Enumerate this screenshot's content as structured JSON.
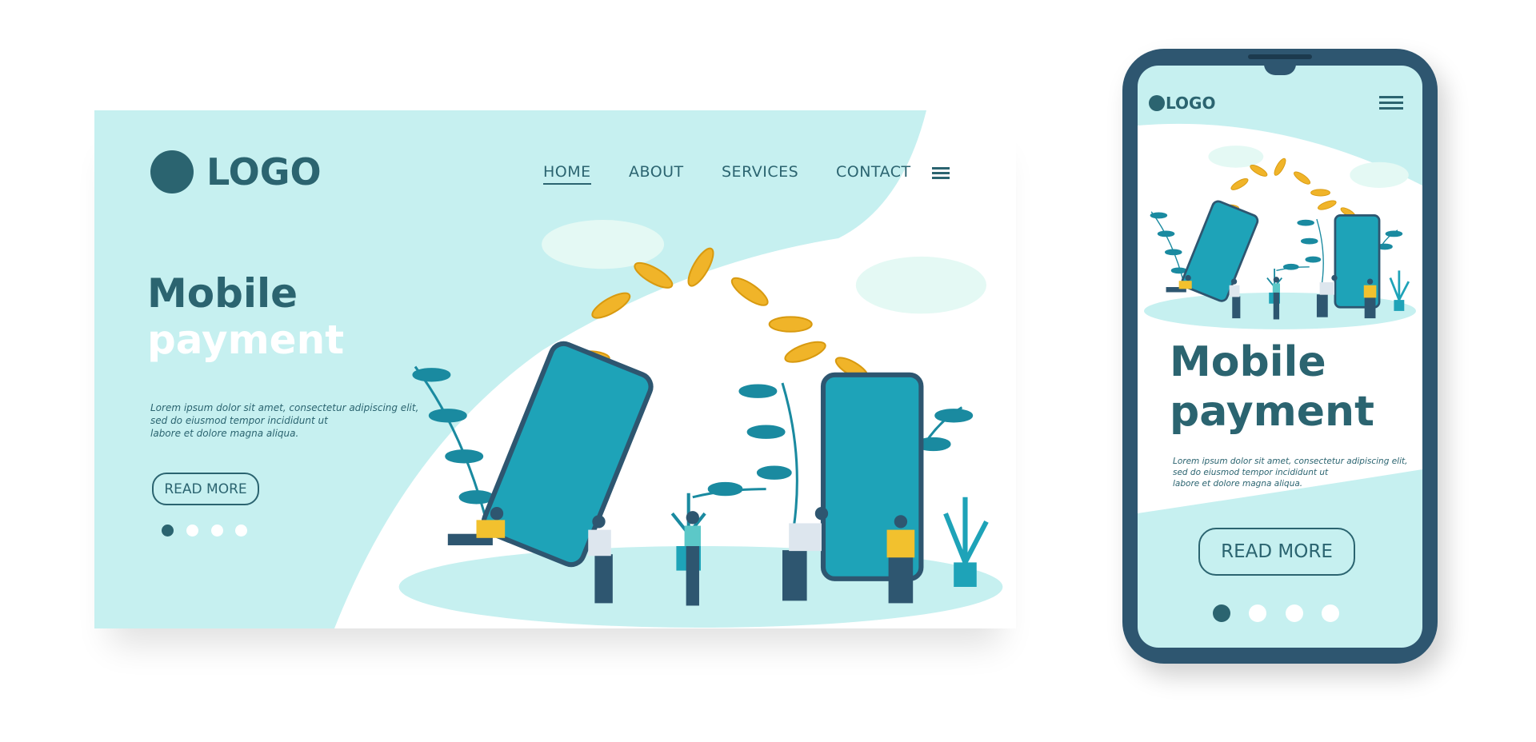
{
  "desktop": {
    "logo": "LOGO",
    "nav": [
      {
        "label": "HOME",
        "active": true
      },
      {
        "label": "ABOUT"
      },
      {
        "label": "SERVICES"
      },
      {
        "label": "CONTACT"
      }
    ],
    "menu_icon": "hamburger-icon",
    "title_line1": "Mobile",
    "title_line2": "payment",
    "body": [
      "Lorem ipsum dolor sit amet, consectetur adipiscing elit,",
      "sed do eiusmod tempor incididunt ut",
      "labore et dolore magna aliqua."
    ],
    "cta": "READ MORE",
    "slides": {
      "count": 4,
      "active": 1
    }
  },
  "mobile": {
    "logo": "LOGO",
    "menu_icon": "hamburger-icon",
    "title_line1": "Mobile",
    "title_line2": "payment",
    "body": [
      "Lorem ipsum dolor sit amet, consectetur adipiscing elit,",
      "sed do eiusmod tempor incididunt ut",
      "labore et dolore magna aliqua."
    ],
    "cta": "READ MORE",
    "slides": {
      "count": 4,
      "active": 1
    }
  },
  "colors": {
    "bg": "#c6f0f0",
    "primary": "#2b6470",
    "phone_frame": "#2e5670",
    "accent_teal": "#1ea3b8",
    "coin": "#f0b429",
    "shirt": "#f2c12e"
  }
}
